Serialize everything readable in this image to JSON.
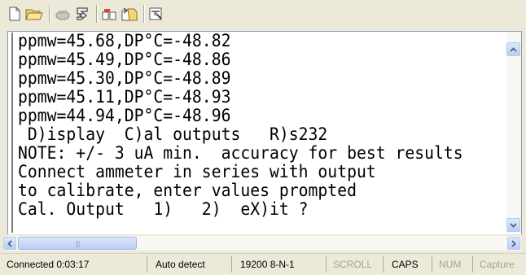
{
  "toolbar": {
    "icons": [
      "new-file-icon",
      "open-folder-icon",
      "connect-icon",
      "disconnect-icon",
      "send-icon",
      "receive-icon",
      "properties-icon"
    ]
  },
  "terminal": {
    "lines": [
      "ppmw=45.68,DP°C=-48.82",
      "ppmw=45.49,DP°C=-48.86",
      "ppmw=45.30,DP°C=-48.89",
      "ppmw=45.11,DP°C=-48.93",
      "ppmw=44.94,DP°C=-48.96",
      " D)isplay  C)al outputs   R)s232",
      "NOTE: +/- 3 uA min.  accuracy for best results",
      "Connect ammeter in series with output",
      "to calibrate, enter values prompted",
      "Cal. Output   1)   2)  eX)it ?"
    ]
  },
  "status_bar": {
    "connection": "Connected 0:03:17",
    "detect": "Auto detect",
    "port_settings": "19200 8-N-1",
    "scroll": "SCROLL",
    "caps": "CAPS",
    "num": "NUM",
    "capture": "Capture"
  },
  "colors": {
    "background": "#ECE9D8",
    "terminal_bg": "#FFFFFF",
    "scroll_accent": "#C1D3FB"
  }
}
